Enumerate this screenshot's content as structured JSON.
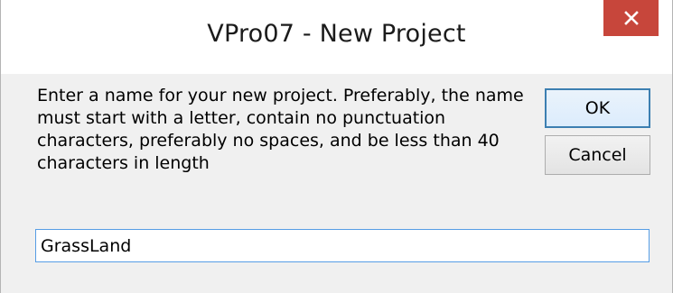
{
  "window": {
    "title": "VPro07 - New Project",
    "close_icon": "close-icon",
    "close_color": "#c7463b"
  },
  "dialog": {
    "message": "Enter a name for your new project.  Preferably, the name must start with a letter, contain no punctuation characters, preferably no spaces, and be less than 40 characters in length",
    "ok_label": "OK",
    "cancel_label": "Cancel",
    "project_name_value": "GrassLand"
  }
}
